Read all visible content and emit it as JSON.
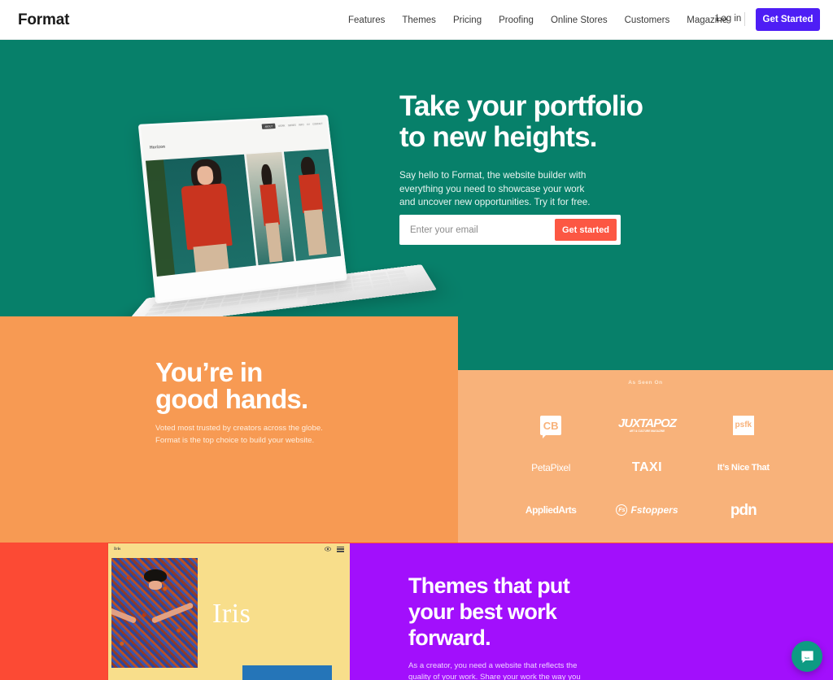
{
  "header": {
    "brand": "Format",
    "nav": [
      {
        "label": "Features"
      },
      {
        "label": "Themes"
      },
      {
        "label": "Pricing"
      },
      {
        "label": "Proofing"
      },
      {
        "label": "Online Stores"
      },
      {
        "label": "Customers"
      },
      {
        "label": "Magazine"
      }
    ],
    "login_label": "Log in",
    "cta_label": "Get Started",
    "cta_color": "#4E1EF5"
  },
  "hero": {
    "background_color": "#07806A",
    "title_line1": "Take your portfolio",
    "title_line2": "to new heights.",
    "subtitle": "Say hello to Format, the website builder with everything you need to showcase your work and uncover new opportunities. Try it for free.",
    "email_placeholder": "Enter your email",
    "email_value": "",
    "submit_label": "Get started",
    "submit_color": "#FC5743",
    "mockup": {
      "site_name": "Horizon",
      "nav_items": [
        "ABOUT",
        "WORK",
        "SERIES",
        "INFO",
        "CV",
        "CONTACT"
      ]
    }
  },
  "good_hands": {
    "background_color": "#F79A53",
    "title_line1": "You’re in",
    "title_line2": "good hands.",
    "subtitle_line1": "Voted most trusted by creators across the globe.",
    "subtitle_line2": "Format is the top choice to build your website."
  },
  "as_seen_on": {
    "background_color": "#F8B27A",
    "label": "As Seen On",
    "logos": [
      {
        "name": "CB",
        "key": "cb"
      },
      {
        "name": "JUXTAPOZ",
        "tagline": "ART & CULTURE MAGAZINE",
        "key": "juxtapoz"
      },
      {
        "name": "psfk",
        "key": "psfk"
      },
      {
        "name": "PetaPixel",
        "key": "petapixel"
      },
      {
        "name": "TAXI",
        "key": "taxi"
      },
      {
        "name": "It’s Nice That",
        "key": "itsnicethat"
      },
      {
        "name": "AppliedArts",
        "key": "appliedarts"
      },
      {
        "name": "Fstoppers",
        "mark": "Fs",
        "key": "fstoppers"
      },
      {
        "name": "pdn",
        "key": "pdn"
      }
    ]
  },
  "themes": {
    "background_color": "#A20FFC",
    "accent_red": "#FC4A34",
    "title_line1": "Themes that put",
    "title_line2": "your best work",
    "title_line3": "forward.",
    "subtitle": "As a creator, you need a website that reflects the quality of your work. Share your work the way you",
    "preview": {
      "theme_name": "Iris",
      "display_title": "Iris",
      "background_color": "#F8DE8B"
    }
  },
  "widgets": {
    "intercom_label": "Open messenger"
  }
}
